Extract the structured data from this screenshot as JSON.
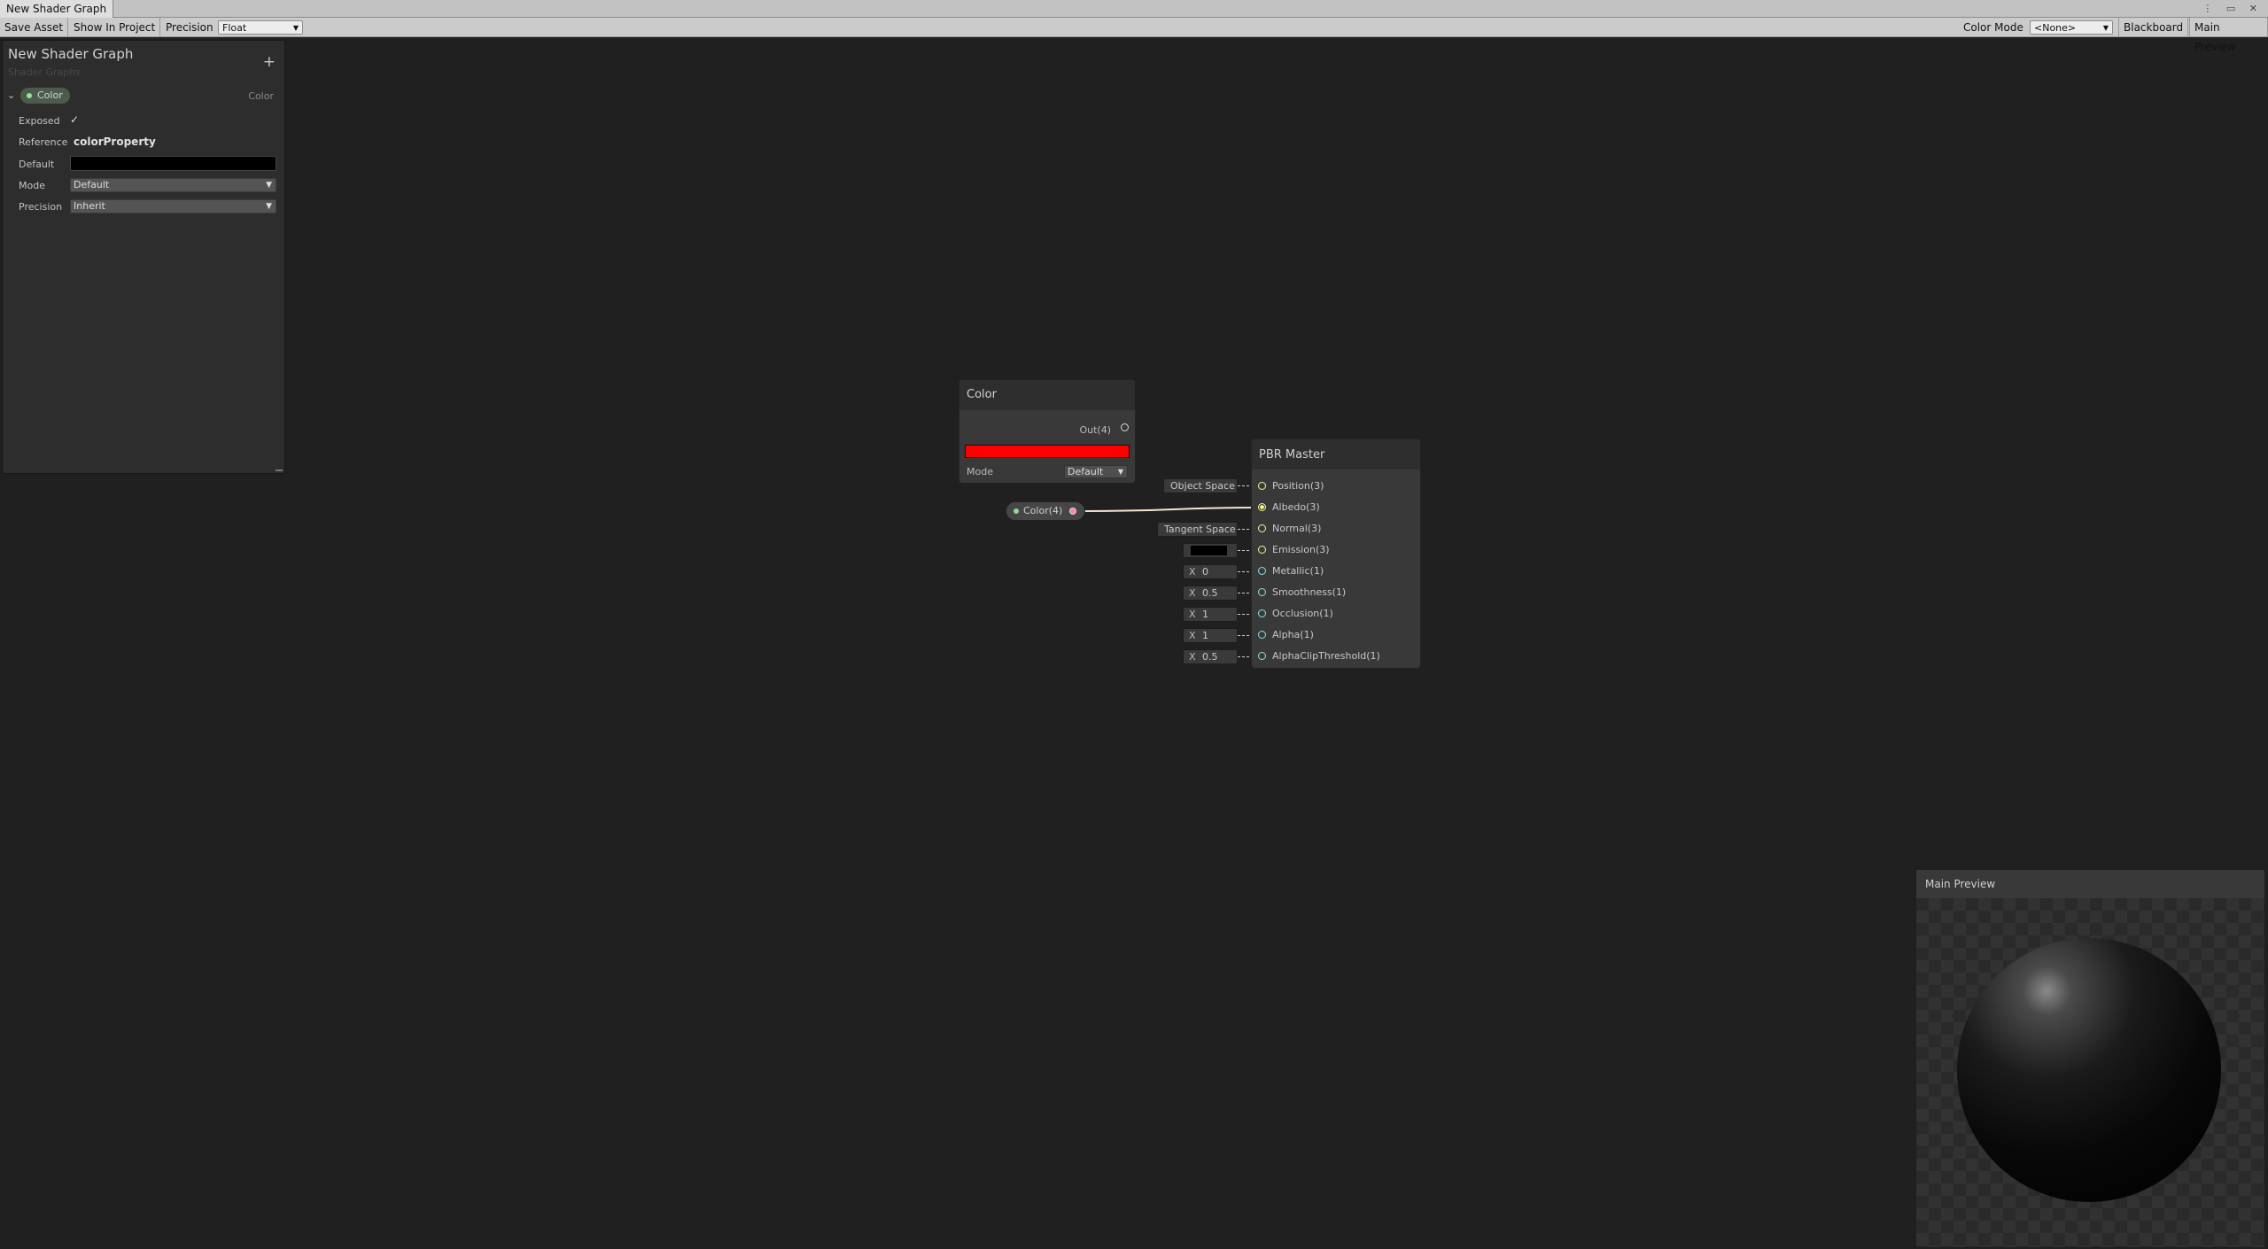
{
  "window": {
    "tab_title": "New Shader Graph",
    "window_icons": "⋮ ▭ ✕"
  },
  "toolbar": {
    "save_asset": "Save Asset",
    "show_in_project": "Show In Project",
    "precision_label": "Precision",
    "precision_value": "Float",
    "color_mode_label": "Color Mode",
    "color_mode_value": "<None>",
    "blackboard": "Blackboard",
    "main_preview": "Main Preview"
  },
  "blackboard": {
    "title": "New Shader Graph",
    "subtitle": "Shader Graphs",
    "add_icon": "+",
    "property": {
      "name": "Color",
      "type": "Color",
      "exposed_label": "Exposed",
      "exposed": true,
      "reference_label": "Reference",
      "reference_value": "colorProperty",
      "default_label": "Default",
      "default_color": "#000000",
      "mode_label": "Mode",
      "mode_value": "Default",
      "precision_label": "Precision",
      "precision_value": "Inherit"
    }
  },
  "nodes": {
    "color": {
      "title": "Color",
      "out_label": "Out(4)",
      "swatch": "#ff0000",
      "mode_label": "Mode",
      "mode_value": "Default"
    },
    "property": {
      "label": "Color(4)"
    },
    "pbr_master": {
      "title": "PBR Master",
      "ports": [
        {
          "label": "Position(3)",
          "color": "#f7f78e",
          "connected": false,
          "default": "Object Space"
        },
        {
          "label": "Albedo(3)",
          "color": "#f7f78e",
          "connected": true,
          "default": ""
        },
        {
          "label": "Normal(3)",
          "color": "#f7f78e",
          "connected": false,
          "default": "Tangent Space"
        },
        {
          "label": "Emission(3)",
          "color": "#f7f78e",
          "connected": false,
          "default_color": "#000000"
        },
        {
          "label": "Metallic(1)",
          "color": "#84e4e7",
          "connected": false,
          "default": "0"
        },
        {
          "label": "Smoothness(1)",
          "color": "#84e4e7",
          "connected": false,
          "default": "0.5"
        },
        {
          "label": "Occlusion(1)",
          "color": "#84e4e7",
          "connected": false,
          "default": "1"
        },
        {
          "label": "Alpha(1)",
          "color": "#84e4e7",
          "connected": false,
          "default": "1"
        },
        {
          "label": "AlphaClipThreshold(1)",
          "color": "#84e4e7",
          "connected": false,
          "default": "0.5"
        }
      ]
    }
  },
  "chips": {
    "x_prefix": "X"
  },
  "preview": {
    "title": "Main Preview"
  },
  "icons": {
    "chevron_down": "⌄",
    "dropdown_arrow": "▼",
    "checkmark": "✓",
    "expand_chevron": "⌄"
  }
}
